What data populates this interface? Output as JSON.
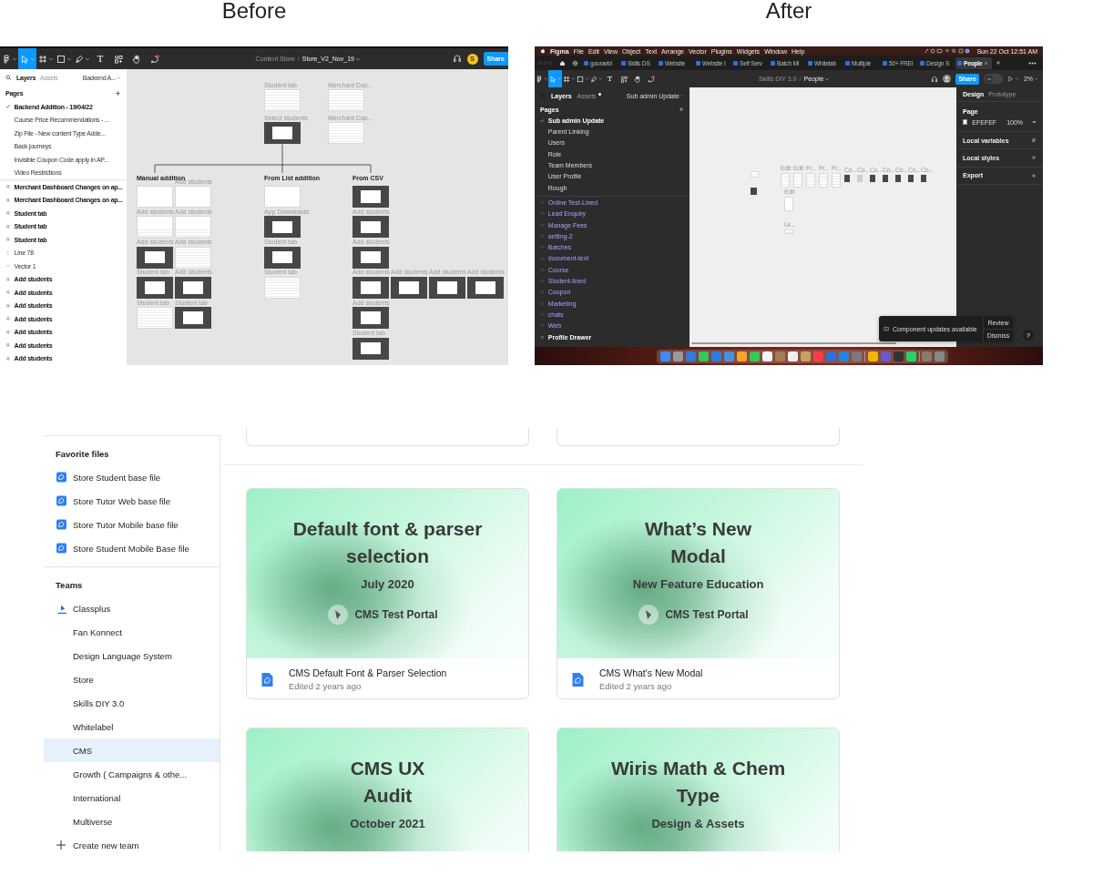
{
  "captions": [
    {
      "text": "Before"
    },
    {
      "text": "After"
    }
  ],
  "before": {
    "tools": [
      {
        "kind": "main-menu",
        "selected": false
      },
      {
        "kind": "move",
        "selected": true
      },
      {
        "kind": "frame",
        "selected": false
      },
      {
        "kind": "shape",
        "selected": false
      },
      {
        "kind": "pen",
        "selected": false
      },
      {
        "kind": "text",
        "glyph": "T",
        "selected": false
      },
      {
        "kind": "resources",
        "selected": false
      },
      {
        "kind": "hand",
        "selected": false
      },
      {
        "kind": "comment",
        "selected": false
      }
    ],
    "breadcrumb": {
      "project": "Content Store",
      "separator": "/",
      "file": "Store_V2_Nov_19"
    },
    "avatar": "S",
    "share": "Share",
    "panel_tabs": [
      {
        "label": "Layers",
        "selected": true
      },
      {
        "label": "Assets",
        "selected": false
      }
    ],
    "page_menu": "Backend A...",
    "pages_title": "Pages",
    "pages": [
      {
        "label": "Backend Addition - 19/04/22",
        "selected": true
      },
      {
        "label": "Course Price Recommendations - ...",
        "selected": false
      },
      {
        "label": "Zip File - New content Type Adde...",
        "selected": false
      },
      {
        "label": "Back journeys",
        "selected": false
      },
      {
        "label": "Invisible Coupon Code apply in AP...",
        "selected": false
      },
      {
        "label": "Video Restrictions",
        "selected": false
      }
    ],
    "layers": [
      {
        "kind": "frame",
        "label": "Merchant Dashboard Changes on ap..."
      },
      {
        "kind": "frame",
        "label": "Merchant Dashboard Changes on ap..."
      },
      {
        "kind": "frame",
        "label": "Student tab"
      },
      {
        "kind": "frame",
        "label": "Student tab"
      },
      {
        "kind": "frame",
        "label": "Student tab"
      },
      {
        "kind": "line",
        "label": "Line 78"
      },
      {
        "kind": "vector",
        "label": "Vector 1"
      },
      {
        "kind": "frame",
        "label": "Add students"
      },
      {
        "kind": "frame",
        "label": "Add students"
      },
      {
        "kind": "frame",
        "label": "Add students"
      },
      {
        "kind": "frame",
        "label": "Add students"
      },
      {
        "kind": "frame",
        "label": "Add students"
      },
      {
        "kind": "frame",
        "label": "Add students"
      },
      {
        "kind": "frame",
        "label": "Add students"
      }
    ],
    "canvas": {
      "top_columns": [
        [
          {
            "label": "Student tab",
            "kind": "light"
          },
          {
            "label": "Select students",
            "kind": "dark"
          }
        ],
        [
          {
            "label": "Merchant Das...",
            "kind": "light"
          },
          {
            "label": "Merchant Das...",
            "kind": "light"
          }
        ]
      ],
      "branches": [
        {
          "title": "Manual addition",
          "columns": [
            [
              {
                "kind": "light"
              },
              {
                "label": "Add students",
                "kind": "light"
              },
              {
                "label": "Add students",
                "kind": "dark"
              },
              {
                "label": "Student tab",
                "kind": "dark"
              },
              {
                "label": "Student tab",
                "kind": "light"
              }
            ],
            [
              {
                "label": "Add students",
                "kind": "light"
              },
              {
                "label": "Add students",
                "kind": "light"
              },
              {
                "label": "Add students",
                "kind": "light"
              },
              {
                "label": "Add students",
                "kind": "dark"
              },
              {
                "label": "Student tab",
                "kind": "dark"
              }
            ]
          ]
        },
        {
          "title": "From List addition",
          "columns": [
            [
              {
                "kind": "light"
              },
              {
                "label": "App Downloads",
                "kind": "dark"
              },
              {
                "label": "Student tab",
                "kind": "dark"
              },
              {
                "label": "Student tab",
                "kind": "light"
              }
            ]
          ]
        },
        {
          "title": "From CSV",
          "columns": [
            [
              {
                "kind": "dark"
              },
              {
                "label": "Add students",
                "kind": "dark"
              },
              {
                "label": "Add students",
                "kind": "dark"
              },
              {
                "label": "Add students",
                "kind": "dark"
              },
              {
                "label": "Add students",
                "kind": "dark"
              },
              {
                "label": "Student tab",
                "kind": "dark"
              }
            ]
          ],
          "row": [
            {
              "label": "Add students",
              "kind": "dark"
            },
            {
              "label": "Add students",
              "kind": "dark"
            },
            {
              "label": "Add students",
              "kind": "dark"
            }
          ]
        }
      ]
    }
  },
  "after": {
    "menu_bar": {
      "app": "Figma",
      "items": [
        "File",
        "Edit",
        "View",
        "Object",
        "Text",
        "Arrange",
        "Vector",
        "Plugins",
        "Widgets",
        "Window",
        "Help"
      ],
      "clock": "Sun 22 Oct  12:51 AM"
    },
    "tabs": [
      {
        "label": "gouravbi",
        "selected": false
      },
      {
        "label": "Skills DS",
        "selected": false
      },
      {
        "label": "Website",
        "selected": false
      },
      {
        "label": "Website I",
        "selected": false
      },
      {
        "label": "Self Serv",
        "selected": false
      },
      {
        "label": "Batch Mi",
        "selected": false
      },
      {
        "label": "Whitelab",
        "selected": false
      },
      {
        "label": "Multiple",
        "selected": false
      },
      {
        "label": "50+ FREI",
        "selected": false
      },
      {
        "label": "Design S",
        "selected": false
      },
      {
        "label": "People",
        "selected": true
      }
    ],
    "tools": [
      {
        "kind": "main-menu",
        "selected": false
      },
      {
        "kind": "move",
        "selected": true
      },
      {
        "kind": "frame",
        "selected": false
      },
      {
        "kind": "shape",
        "selected": false
      },
      {
        "kind": "pen",
        "selected": false
      },
      {
        "kind": "text",
        "glyph": "T",
        "selected": false
      },
      {
        "kind": "resources",
        "selected": false
      },
      {
        "kind": "hand",
        "selected": false
      },
      {
        "kind": "comment",
        "selected": false
      }
    ],
    "breadcrumb": {
      "project": "Skills DIY 3.0",
      "separator": "/",
      "file": "People"
    },
    "share": "Share",
    "dev_mode": {
      "on": false
    },
    "zoom": "2%",
    "panel_tabs": [
      {
        "label": "Layers",
        "selected": true
      },
      {
        "label": "Assets",
        "selected": false,
        "badge": true
      }
    ],
    "page_menu": "Sub admin Update",
    "pages_title": "Pages",
    "pages": [
      {
        "label": "Sub admin Update",
        "selected": true
      },
      {
        "label": "Parent Linking",
        "selected": false
      },
      {
        "label": "Users",
        "selected": false
      },
      {
        "label": "Role",
        "selected": false
      },
      {
        "label": "Team Members",
        "selected": false
      },
      {
        "label": "User Profile",
        "selected": false
      },
      {
        "label": "Rough",
        "selected": false
      }
    ],
    "layers": [
      {
        "kind": "component",
        "label": "Online Test-Lined"
      },
      {
        "kind": "component",
        "label": "Lead Enquiry"
      },
      {
        "kind": "component",
        "label": "Manage Fees"
      },
      {
        "kind": "component",
        "label": "setting-2"
      },
      {
        "kind": "component",
        "label": "Batches"
      },
      {
        "kind": "component",
        "label": "document-text"
      },
      {
        "kind": "component",
        "label": "Course"
      },
      {
        "kind": "component",
        "label": "Student-lined"
      },
      {
        "kind": "component",
        "label": "Coupon"
      },
      {
        "kind": "component",
        "label": "Marketing"
      },
      {
        "kind": "component",
        "label": "chats"
      },
      {
        "kind": "component",
        "label": "Web"
      },
      {
        "kind": "frame",
        "label": "Profile Drawer"
      }
    ],
    "design_tabs": [
      {
        "label": "Design",
        "selected": true
      },
      {
        "label": "Prototype",
        "selected": false
      }
    ],
    "page_section": {
      "title": "Page",
      "hex": "EFEFEF",
      "opacity": "100%"
    },
    "sections": [
      {
        "label": "Local variables",
        "kind": "variables"
      },
      {
        "label": "Local styles",
        "kind": "add"
      },
      {
        "label": "Export",
        "kind": "add"
      }
    ],
    "canvas": {
      "row": [
        {
          "label": "Edit",
          "kind": "light"
        },
        {
          "label": "Edit",
          "kind": "light"
        },
        {
          "label": "Fr...",
          "kind": "light"
        },
        {
          "label": "Fr...",
          "kind": "light"
        },
        {
          "label": "Fr...",
          "kind": "light"
        },
        {
          "label": "Co...",
          "kind": "dark"
        },
        {
          "label": "Co...",
          "kind": "grey"
        },
        {
          "label": "Co...",
          "kind": "dark"
        },
        {
          "label": "Co...",
          "kind": "dark"
        },
        {
          "label": "Co...",
          "kind": "dark"
        },
        {
          "label": "Co...",
          "kind": "dark"
        },
        {
          "label": "Co...",
          "kind": "dark"
        }
      ],
      "column": [
        {
          "label": "Edit",
          "kind": "light"
        },
        {
          "label": "Lk...",
          "kind": "strip"
        }
      ]
    },
    "toast": {
      "message": "Component updates available",
      "actions": [
        "Review",
        "Dismiss"
      ]
    },
    "help": "?"
  },
  "browser": {
    "favorites_title": "Favorite files",
    "favorites": [
      "Store Student base file",
      "Store Tutor Web base file",
      "Store Tutor Mobile base file",
      "Store Student Mobile Base file"
    ],
    "teams_title": "Teams",
    "teams": [
      {
        "label": "Classplus",
        "kind": "logo",
        "selected": false
      },
      {
        "label": "Fan Konnect",
        "kind": "plain",
        "selected": false
      },
      {
        "label": "Design Language System",
        "kind": "plain",
        "selected": false
      },
      {
        "label": "Store",
        "kind": "plain",
        "selected": false
      },
      {
        "label": "Skills DIY 3.0",
        "kind": "plain",
        "selected": false
      },
      {
        "label": "Whitelabel",
        "kind": "plain",
        "selected": false
      },
      {
        "label": "CMS",
        "kind": "plain",
        "selected": true
      },
      {
        "label": "Growth ( Campaigns & othe...",
        "kind": "plain",
        "selected": false
      },
      {
        "label": "International",
        "kind": "plain",
        "selected": false
      },
      {
        "label": "Multiverse",
        "kind": "plain",
        "selected": false
      }
    ],
    "create_team": "Create new team",
    "files": [
      {
        "title_lines": [
          "Default font & parser",
          "selection"
        ],
        "subtitle": "July 2020",
        "badge": "CMS Test Portal",
        "name": "CMS Default Font & Parser Selection",
        "edited": "Edited 2 years ago"
      },
      {
        "title_lines": [
          "What’s New",
          "Modal"
        ],
        "subtitle": "New Feature Education",
        "badge": "CMS Test Portal",
        "name": "CMS What's New Modal",
        "edited": "Edited 2 years ago"
      },
      {
        "title_lines": [
          "CMS UX",
          "Audit"
        ],
        "subtitle": "October 2021"
      },
      {
        "title_lines": [
          "Wiris Math & Chem",
          "Type"
        ],
        "subtitle": "Design & Assets"
      }
    ]
  }
}
